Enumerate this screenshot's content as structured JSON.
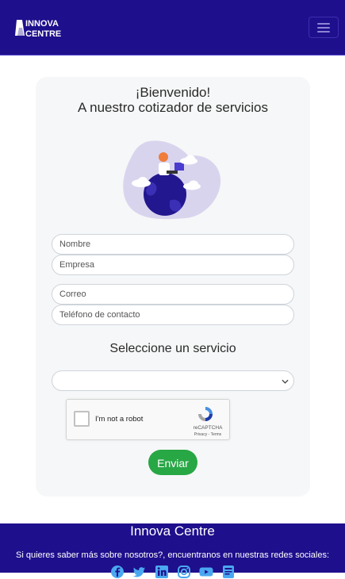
{
  "brand": {
    "line1": "INNOVA",
    "line2": "CENTRE"
  },
  "form": {
    "welcome_line1": "¡Bienvenido!",
    "welcome_line2": "A nuestro cotizador de servicios",
    "nombre_placeholder": "Nombre",
    "empresa_placeholder": "Empresa",
    "correo_placeholder": "Correo",
    "telefono_placeholder": "Teléfono de contacto",
    "service_title": "Seleccione un servicio",
    "service_selected": "",
    "submit_label": "Enviar"
  },
  "captcha": {
    "label": "I'm not a robot",
    "brand": "reCAPTCHA",
    "privacy": "Privacy",
    "terms": "Terms"
  },
  "footer": {
    "title": "Innova Centre",
    "text": "Si quieres saber más sobre nosotros?, encuentranos en nuestras redes sociales:",
    "socials": [
      "facebook-icon",
      "twitter-icon",
      "linkedin-icon",
      "instagram-icon",
      "youtube-icon",
      "blog-icon"
    ]
  },
  "colors": {
    "primary": "#1e0f8c",
    "success": "#28a745",
    "card": "#f6f7f8"
  }
}
